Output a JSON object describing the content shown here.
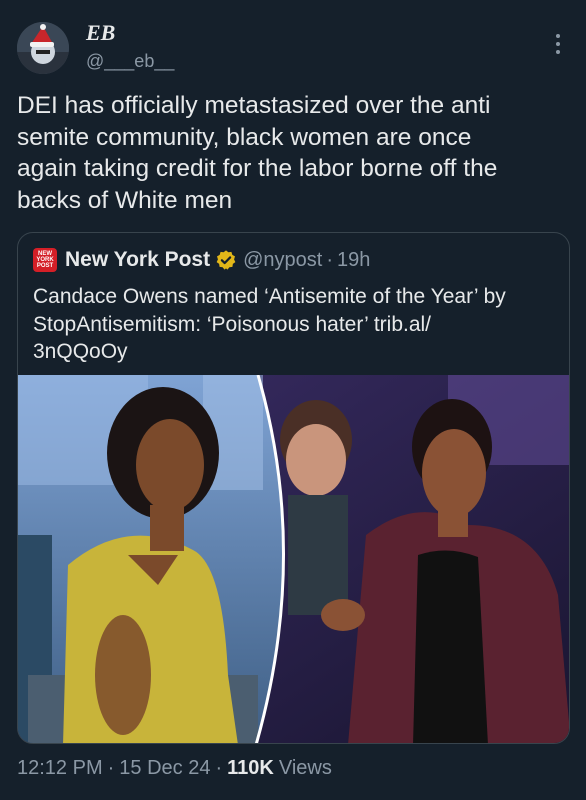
{
  "author": {
    "display_name": "EB",
    "handle": "@___eb__"
  },
  "tweet": {
    "text": "DEI has officially metastasized over the anti\nsemite community, black women are once\nagain taking credit for the labor borne off the\nbacks of White men"
  },
  "quoted_tweet": {
    "logo_text": "NEW YORK POST",
    "name": "New York Post",
    "handle": "@nypost",
    "dot": "·",
    "time": "19h",
    "text": "Candace Owens named ‘Antisemite of the Year’ by\nStopAntisemitism: ‘Poisonous hater’ trib.al/\n3nQQoOy"
  },
  "footer": {
    "time": "12:12 PM",
    "sep1": "·",
    "date": "15 Dec 24",
    "sep2": "·",
    "views_count": "110K",
    "views_label": "Views"
  },
  "colors": {
    "background": "#15202b",
    "text": "#e7e9ea",
    "secondary_text": "#8b98a5",
    "border": "#38444d",
    "nyp_red": "#d41f27",
    "verified_gold": "#e2b719"
  },
  "icons": {
    "more": "more-vertical-icon",
    "verified": "verified-gold-badge-icon"
  }
}
